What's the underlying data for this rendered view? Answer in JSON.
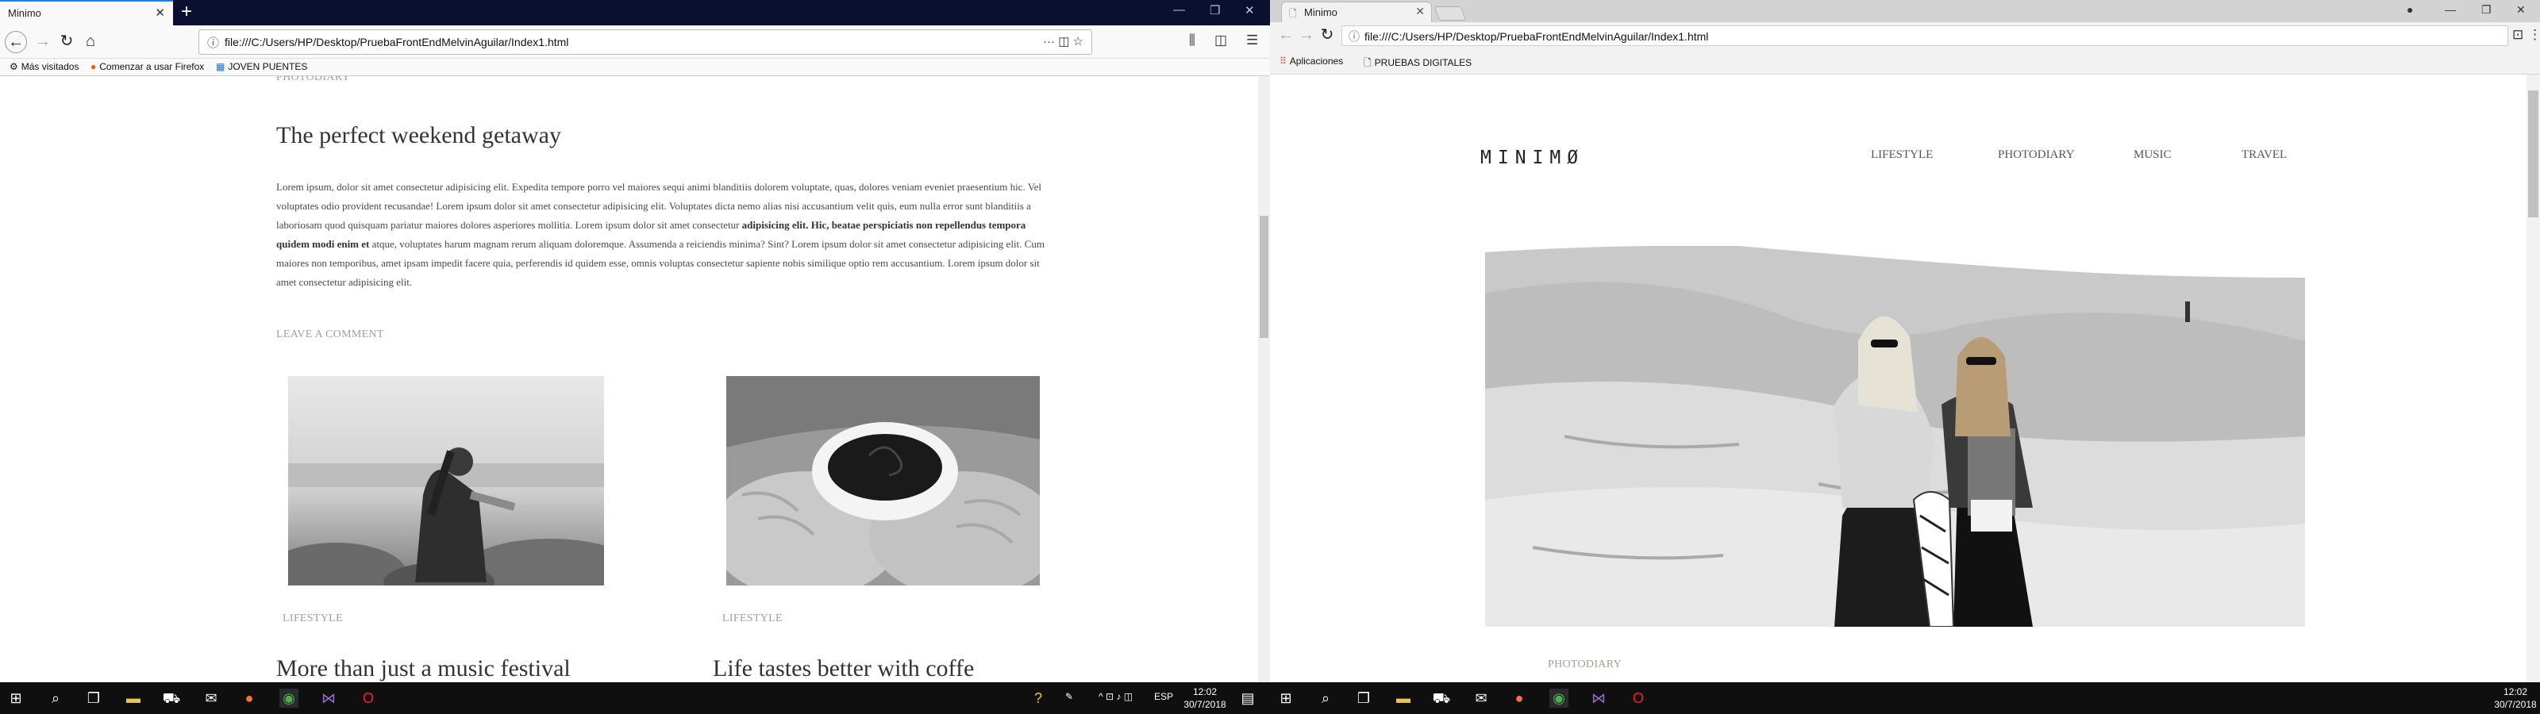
{
  "left_window": {
    "tab_title": "Minimo",
    "url": "file:///C:/Users/HP/Desktop/PruebaFrontEndMelvinAguilar/Index1.html",
    "bookmarks": [
      "Más visitados",
      "Comenzar a usar Firefox",
      "JOVEN PUENTES"
    ],
    "page": {
      "top_category": "PHOTODIARY",
      "post_title": "The perfect weekend getaway",
      "body_part1": "Lorem ipsum, dolor sit amet consectetur adipisicing elit. Expedita tempore porro vel maiores sequi animi blanditiis dolorem voluptate, quas, dolores veniam eveniet praesentium hic. Vel voluptates odio provident recusandae! Lorem ipsum dolor sit amet consectetur adipisicing elit. Voluptates dicta nemo alias nisi accusantium velit quis, eum nulla error sunt blanditiis a laboriosam quod quisquam pariatur maiores dolores asperiores mollitia. Lorem ipsum dolor sit amet consectetur ",
      "body_bold": "adipisicing elit. Hic, beatae perspiciatis non repellendus tempora quidem modi enim et",
      "body_part2": " atque, voluptates harum magnam rerum aliquam doloremque. Assumenda a reiciendis minima? Sint? Lorem ipsum dolor sit amet consectetur adipisicing elit. Cum maiores non temporibus, amet ipsam impedit facere quia, perferendis id quidem esse, omnis voluptas consectetur sapiente nobis similique optio rem accusantium. Lorem ipsum dolor sit amet consectetur adipisicing elit.",
      "leave_comment": "LEAVE A COMMENT",
      "cards": [
        {
          "category": "LIFESTYLE",
          "title": "More than just a music festival"
        },
        {
          "category": "LIFESTYLE",
          "title": "Life tastes better with coffe"
        }
      ]
    }
  },
  "right_window": {
    "tab_title": "Minimo",
    "url": "file:///C:/Users/HP/Desktop/PruebaFrontEndMelvinAguilar/Index1.html",
    "bookmarks": [
      "Aplicaciones",
      "PRUEBAS DIGITALES"
    ],
    "page": {
      "logo": "MINIMØ",
      "menu": [
        "LIFESTYLE",
        "PHOTODIARY",
        "MUSIC",
        "TRAVEL"
      ],
      "hero_category": "PHOTODIARY"
    }
  },
  "taskbars": {
    "left": {
      "time": "12:02",
      "date": "30/7/2018",
      "language": "ESP"
    },
    "right": {
      "time": "12:02",
      "date": "30/7/2018"
    }
  },
  "colors": {
    "firefox_titlebar": "#0c1030",
    "accent": "#0a84ff",
    "category_text": "#a59e96"
  }
}
